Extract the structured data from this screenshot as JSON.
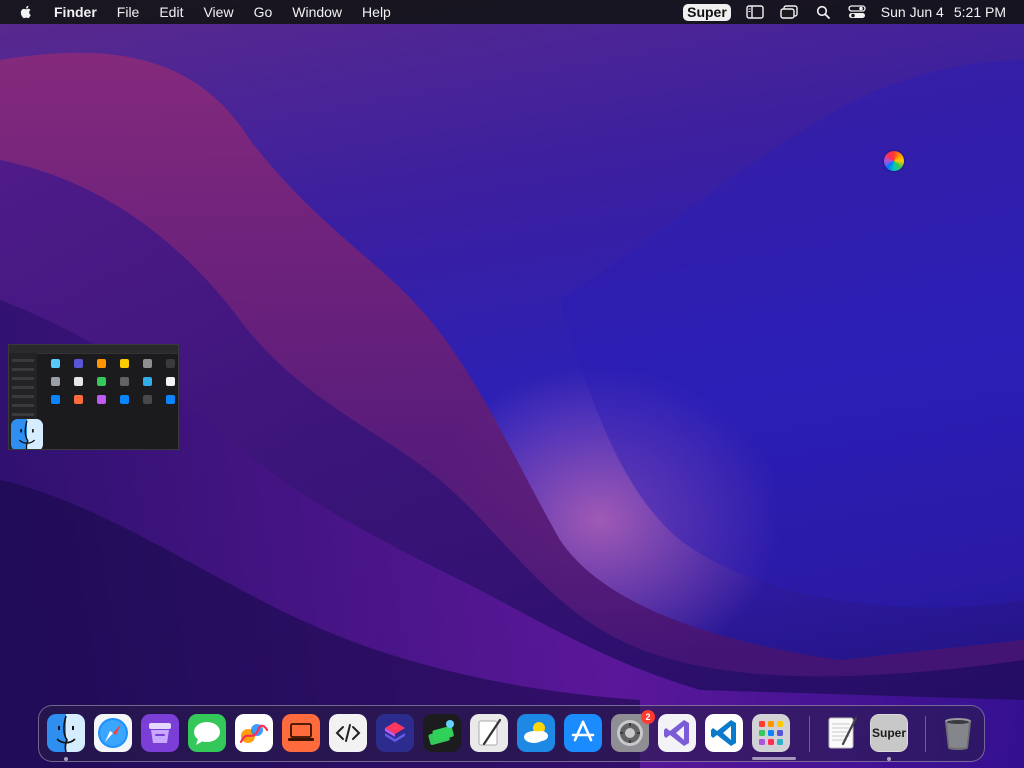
{
  "menubar": {
    "apple_icon": "apple-logo-icon",
    "app_name": "Finder",
    "menus": [
      "File",
      "Edit",
      "View",
      "Go",
      "Window",
      "Help"
    ],
    "super_label": "Super",
    "status_icons": [
      "sidebar-icon",
      "window-icon",
      "search-icon",
      "control-center-icon"
    ],
    "date": "Sun Jun 4",
    "time": "5:21 PM"
  },
  "desktop": {
    "wallpaper": "macOS Monterey purple",
    "color_dot_icon": "color-picker-icon"
  },
  "dock": {
    "apps": [
      {
        "name": "Finder",
        "icon": "finder-icon",
        "running": true
      },
      {
        "name": "Safari",
        "icon": "safari-icon",
        "running": false
      },
      {
        "name": "Podcasts Alt",
        "icon": "archive-icon",
        "running": false
      },
      {
        "name": "Messages",
        "icon": "messages-icon",
        "running": false
      },
      {
        "name": "Freeform",
        "icon": "freeform-icon",
        "running": false
      },
      {
        "name": "Presenter",
        "icon": "laptop-icon",
        "running": false
      },
      {
        "name": "Code Editor",
        "icon": "code-icon",
        "running": false
      },
      {
        "name": "Shortcuts",
        "icon": "shortcuts-icon",
        "running": false
      },
      {
        "name": "Money",
        "icon": "money-icon",
        "running": false
      },
      {
        "name": "Script Editor",
        "icon": "script-icon",
        "running": false
      },
      {
        "name": "Weather",
        "icon": "weather-icon",
        "running": false
      },
      {
        "name": "App Store",
        "icon": "app-store-icon",
        "running": false
      },
      {
        "name": "System Settings",
        "icon": "settings-icon",
        "running": false,
        "badge": "2"
      },
      {
        "name": "Visual Studio",
        "icon": "visual-studio-icon",
        "running": false
      },
      {
        "name": "VS Code",
        "icon": "vscode-icon",
        "running": false
      },
      {
        "name": "Launchpad",
        "icon": "launchpad-icon",
        "running": false
      }
    ],
    "recent": [
      {
        "name": "TextEdit",
        "icon": "textedit-icon",
        "running": false
      },
      {
        "name": "Super",
        "icon": "super-app-icon",
        "label": "Super",
        "running": true
      }
    ],
    "trash": {
      "name": "Trash",
      "icon": "trash-icon"
    }
  }
}
